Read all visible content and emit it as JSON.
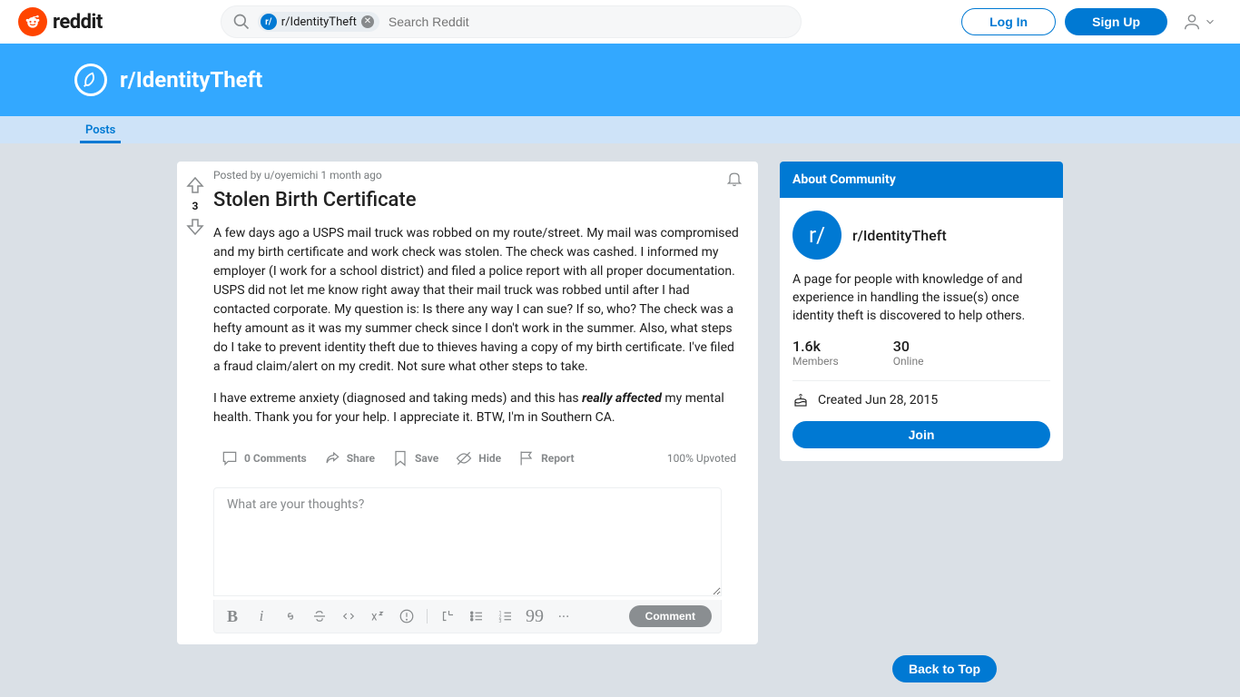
{
  "brand": "reddit",
  "search": {
    "chip_label": "r/IdentityTheft",
    "chip_avatar": "r/",
    "placeholder": "Search Reddit"
  },
  "header": {
    "login": "Log In",
    "signup": "Sign Up"
  },
  "banner": {
    "subreddit": "r/IdentityTheft"
  },
  "tabs": {
    "posts": "Posts"
  },
  "post": {
    "score": "3",
    "posted_by_prefix": "Posted by ",
    "author": "u/oyemichi",
    "time": " 1 month ago",
    "title": "Stolen Birth Certificate",
    "para1": "A few days ago a USPS mail truck was robbed on my route/street. My mail was compromised and my birth certificate and work check was stolen. The check was cashed. I informed my employer (I work for a school district) and filed a police report with all proper documentation. USPS did not let me know right away that their mail truck was robbed until after I had contacted corporate. My question is: Is there any way I can sue? If so, who? The check was a hefty amount as it was my summer check since I don't work in the summer. Also, what steps do I take to prevent identity theft due to thieves having a copy of my birth certificate. I've filed a fraud claim/alert on my credit. Not sure what other steps to take.",
    "para2_a": "I have extreme anxiety (diagnosed and taking meds) and this has ",
    "para2_em": "really affected",
    "para2_b": " my mental health. Thank you for your help. I appreciate it. BTW, I'm in Southern CA.",
    "actions": {
      "comments": "0 Comments",
      "share": "Share",
      "save": "Save",
      "hide": "Hide",
      "report": "Report"
    },
    "upvoted": "100% Upvoted"
  },
  "comment_box": {
    "placeholder": "What are your thoughts?",
    "submit": "Comment"
  },
  "sidebar": {
    "header": "About Community",
    "avatar": "r/",
    "name": "r/IdentityTheft",
    "desc": "A page for people with knowledge of and experience in handling the issue(s) once identity theft is discovered to help others.",
    "members_num": "1.6k",
    "members_label": "Members",
    "online_num": "30",
    "online_label": "Online",
    "created_prefix": "Created ",
    "created_date": "Jun 28, 2015",
    "join": "Join"
  },
  "back_to_top": "Back to Top"
}
